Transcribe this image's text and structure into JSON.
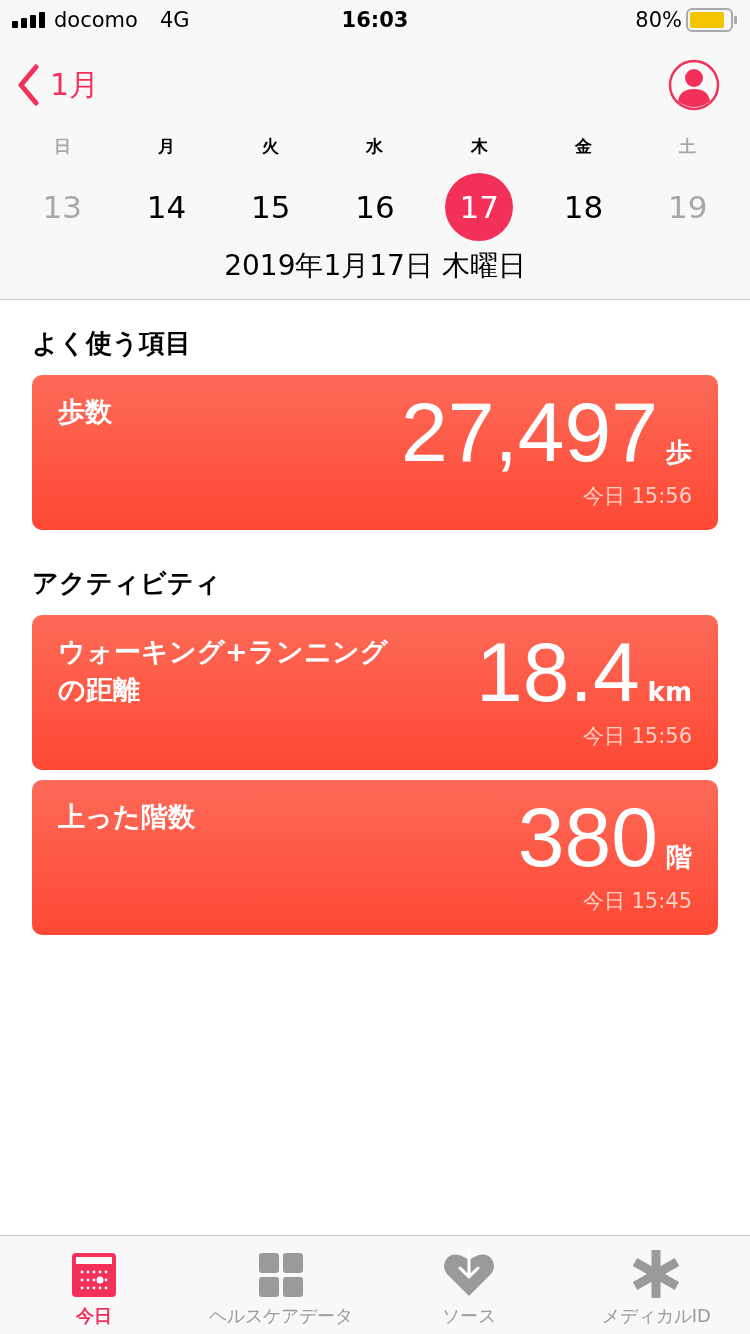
{
  "status_bar": {
    "carrier": "docomo",
    "network": "4G",
    "time": "16:03",
    "battery": "80%"
  },
  "nav": {
    "back": "1月"
  },
  "week": [
    {
      "weekday": "日",
      "date": "13",
      "weekend": true,
      "selected": false
    },
    {
      "weekday": "月",
      "date": "14",
      "weekend": false,
      "selected": false
    },
    {
      "weekday": "火",
      "date": "15",
      "weekend": false,
      "selected": false
    },
    {
      "weekday": "水",
      "date": "16",
      "weekend": false,
      "selected": false
    },
    {
      "weekday": "木",
      "date": "17",
      "weekend": false,
      "selected": true
    },
    {
      "weekday": "金",
      "date": "18",
      "weekend": false,
      "selected": false
    },
    {
      "weekday": "土",
      "date": "19",
      "weekend": true,
      "selected": false
    }
  ],
  "date_title": "2019年1月17日 木曜日",
  "sections": [
    {
      "title": "よく使う項目",
      "cards": [
        {
          "label": "歩数",
          "value": "27,497",
          "unit": "歩",
          "time": "今日 15:56"
        }
      ]
    },
    {
      "title": "アクティビティ",
      "cards": [
        {
          "label": "ウォーキング+ランニングの距離",
          "value": "18.4",
          "unit": "km",
          "time": "今日 15:56"
        },
        {
          "label": "上った階数",
          "value": "380",
          "unit": "階",
          "time": "今日 15:45"
        }
      ]
    }
  ],
  "tab_bar": [
    {
      "label": "今日",
      "kind": "today",
      "selected": true
    },
    {
      "label": "ヘルスケアデータ",
      "kind": "data",
      "selected": false
    },
    {
      "label": "ソース",
      "kind": "sources",
      "selected": false
    },
    {
      "label": "メディカルID",
      "kind": "medical",
      "selected": false
    }
  ]
}
